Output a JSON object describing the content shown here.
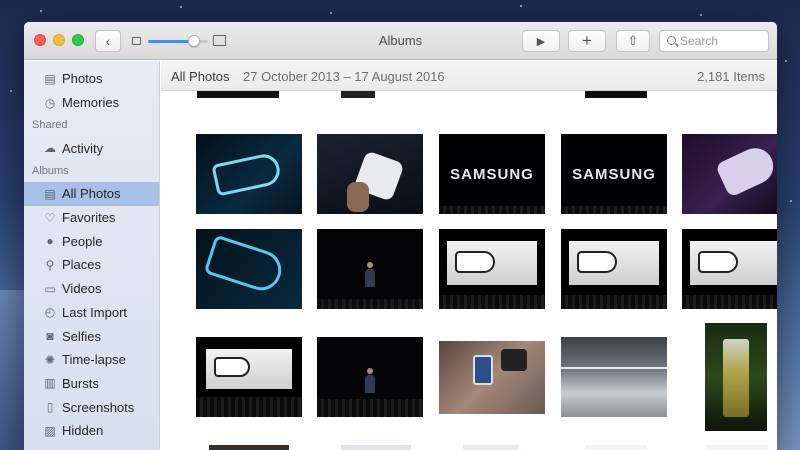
{
  "window": {
    "title": "Albums"
  },
  "toolbar": {
    "back_glyph": "‹",
    "play_glyph": "▶",
    "add_glyph": "+",
    "share_glyph": "⇧",
    "search_placeholder": "Search",
    "zoom_level": 0.78
  },
  "sidebar": {
    "top_items": [
      {
        "label": "Photos",
        "icon": "photos-icon"
      },
      {
        "label": "Memories",
        "icon": "memories-icon"
      }
    ],
    "shared_header": "Shared",
    "shared_items": [
      {
        "label": "Activity",
        "icon": "cloud-icon"
      }
    ],
    "albums_header": "Albums",
    "album_items": [
      {
        "label": "All Photos",
        "icon": "all-photos-icon",
        "selected": true
      },
      {
        "label": "Favorites",
        "icon": "heart-icon"
      },
      {
        "label": "People",
        "icon": "person-icon"
      },
      {
        "label": "Places",
        "icon": "pin-icon"
      },
      {
        "label": "Videos",
        "icon": "video-icon"
      },
      {
        "label": "Last Import",
        "icon": "clock-icon"
      },
      {
        "label": "Selfies",
        "icon": "camera-icon"
      },
      {
        "label": "Time-lapse",
        "icon": "timelapse-icon"
      },
      {
        "label": "Bursts",
        "icon": "bursts-icon"
      },
      {
        "label": "Screenshots",
        "icon": "phone-icon"
      },
      {
        "label": "Hidden",
        "icon": "hidden-icon"
      }
    ]
  },
  "infobar": {
    "title": "All Photos",
    "date_range": "27 October 2013 – 17 August 2016",
    "count": "2,181 Items"
  },
  "photos": {
    "row1": [
      {
        "kind": "vr-blue",
        "text": ""
      },
      {
        "kind": "headset-hands",
        "text": ""
      },
      {
        "kind": "samsung",
        "text": "SAMSUNG"
      },
      {
        "kind": "samsung",
        "text": "SAMSUNG"
      },
      {
        "kind": "vr-purple",
        "text": ""
      }
    ],
    "row2": [
      {
        "kind": "vr-blue",
        "text": ""
      },
      {
        "kind": "stage-person",
        "text": ""
      },
      {
        "kind": "stage-screen",
        "text": ""
      },
      {
        "kind": "stage-screen",
        "text": ""
      },
      {
        "kind": "stage-screen",
        "text": ""
      }
    ],
    "row3": [
      {
        "kind": "stage-screen",
        "text": ""
      },
      {
        "kind": "stage-person",
        "text": ""
      },
      {
        "kind": "phone-photo",
        "text": ""
      },
      {
        "kind": "hall",
        "text": ""
      },
      {
        "kind": "glass",
        "text": ""
      }
    ]
  }
}
